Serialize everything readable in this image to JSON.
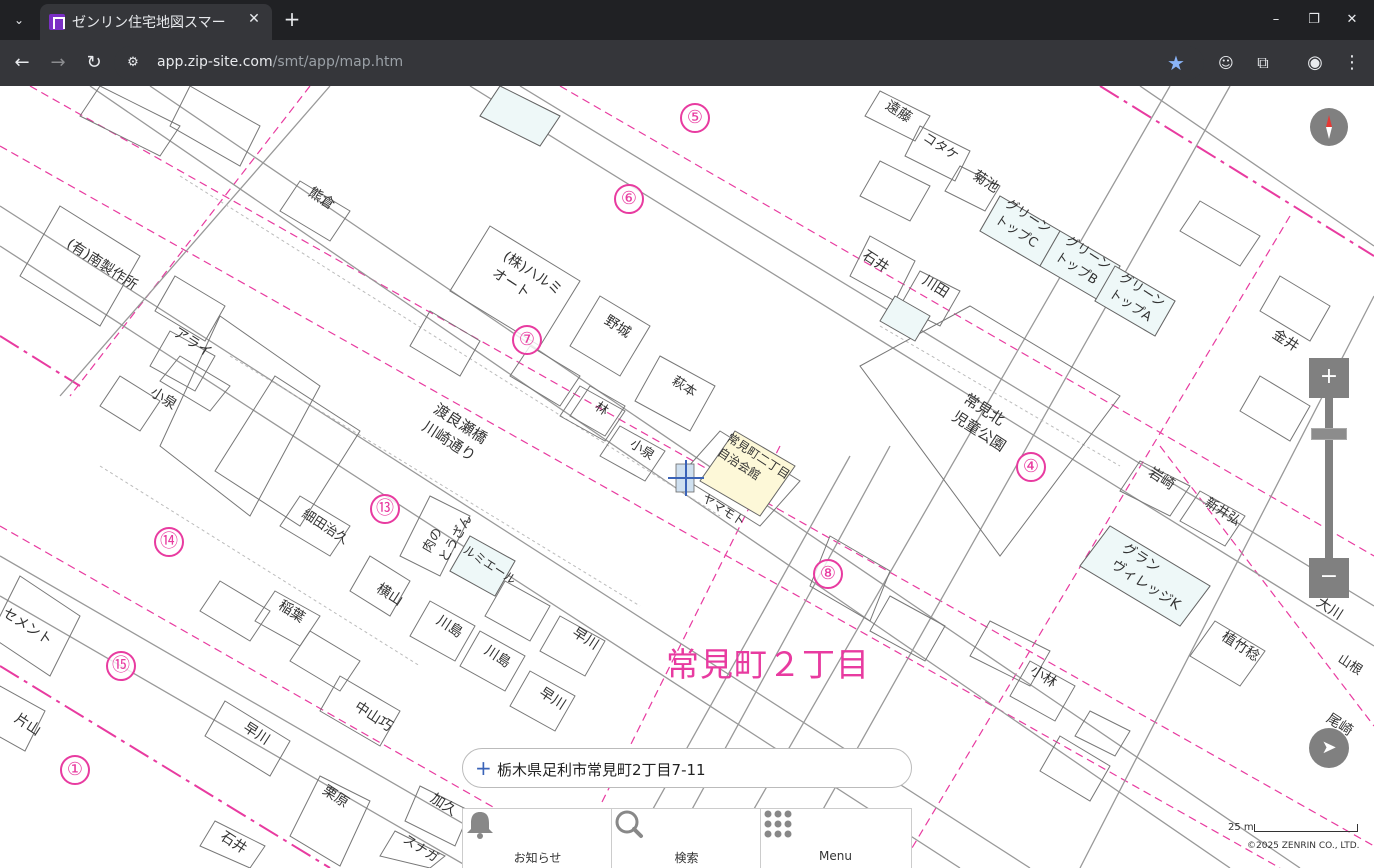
{
  "browser": {
    "tab_title": "ゼンリン住宅地図スマー",
    "tab_close": "✕",
    "new_tab": "+",
    "url_host": "app.zip-site.com",
    "url_path": "/smt/app/map.htm",
    "window_minimize": "–",
    "window_restore": "❐",
    "window_close": "✕"
  },
  "map": {
    "district_name": "常見町２丁目",
    "block_numbers": [
      "⑤",
      "⑥",
      "⑦",
      "④",
      "⑬",
      "⑭",
      "⑧",
      "⑮",
      "①"
    ],
    "labels": {
      "kawasaki_road": "渡良瀬橋\n川崎通り",
      "park": "常見北\n児童公園",
      "community_hall": "常見町二丁目\n自治会館",
      "factory": "(有)南製作所",
      "harumi": "(株)ハルミ\nオート",
      "green_c": "グリーン\nトップC",
      "green_b": "グリーン\nトップB",
      "green_a": "グリーン\nトップA",
      "grand_village": "グラン\nヴィレッジK",
      "cement": "セメント",
      "house_endo": "遠藤",
      "house_kotake": "コタケ",
      "house_kikuchi": "菊池",
      "house_kumakura": "熊倉",
      "house_ishii": "石井",
      "house_kawata": "川田",
      "house_kanei": "金井",
      "house_noshiro": "野城",
      "house_hagimoto": "萩本",
      "house_hayashi": "林",
      "house_koizumi": "小泉",
      "house_koizumi2": "小泉",
      "house_yamamoto": "ヤマモト",
      "house_arai": "アライ",
      "house_iwasaki": "岩崎",
      "house_niihiro": "新井弘",
      "house_uetake": "植竹稔",
      "house_okawa": "大川",
      "house_yamane": "山根",
      "house_kobayashi": "小林",
      "house_ozaki": "尾崎",
      "house_yokoyama": "横山",
      "house_kawashima": "川島",
      "house_kawashima2": "川島",
      "house_hayakawa": "早川",
      "house_hayakawa2": "早川",
      "house_hayakawa3": "早川",
      "house_inaba": "稲葉",
      "house_nakayama": "中山巧",
      "house_hosoda": "細田治久",
      "house_ishii2": "石井",
      "house_kuri": "栗原",
      "house_kataoka": "片山",
      "house_kaku": "加久",
      "house_sunaga": "スナガ",
      "house_nikuya": "肉の\nとうざん",
      "house_lumiere": "ルミエール"
    },
    "compass_icon": "compass-icon",
    "zoom_in": "+",
    "zoom_out": "−",
    "address": "栃木県足利市常見町2丁目7-11",
    "address_plus": "+",
    "scale_label": "25 m",
    "copyright": "©2025 ZENRIN CO., LTD."
  },
  "bottom_menu": [
    {
      "label": "お知らせ",
      "icon": "bell-icon"
    },
    {
      "label": "検索",
      "icon": "search-icon"
    },
    {
      "label": "Menu",
      "icon": "grid-icon"
    }
  ]
}
